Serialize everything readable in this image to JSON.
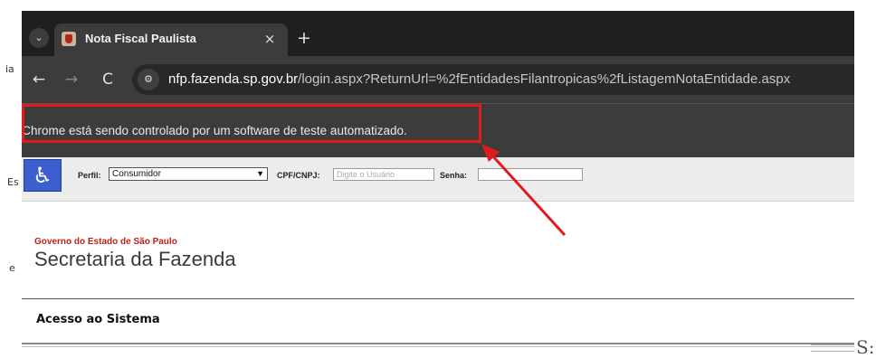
{
  "background": {
    "left_glyphs": [
      "ia",
      "Es",
      "e"
    ]
  },
  "browser": {
    "tab_search_icon": "chevron-down-icon",
    "tab": {
      "title": "Nota Fiscal Paulista",
      "close": "×"
    },
    "new_tab": "+",
    "nav": {
      "back": "←",
      "forward": "→",
      "reload": "C"
    },
    "address": {
      "host": "nfp.fazenda.sp.gov.br",
      "path": "/login.aspx?ReturnUrl=%2fEntidadesFilantropicas%2fListagemNotaEntidade.aspx"
    },
    "infobar_text": "O Chrome está sendo controlado por um software de teste automatizado."
  },
  "page": {
    "login": {
      "perfil_label": "Perfil:",
      "perfil_value": "Consumidor",
      "cpf_label": "CPF/CNPJ:",
      "cpf_placeholder": "Digite o Usuário",
      "senha_label": "Senha:"
    },
    "header": {
      "gov": "Governo do Estado de São Paulo",
      "secretaria": "Secretaria da Fazenda"
    },
    "section_title": "Acesso ao Sistema"
  },
  "right_fragment": "S:",
  "colors": {
    "annotation": "#e01b1b",
    "accessibility_icon": "#3b5fcf"
  }
}
